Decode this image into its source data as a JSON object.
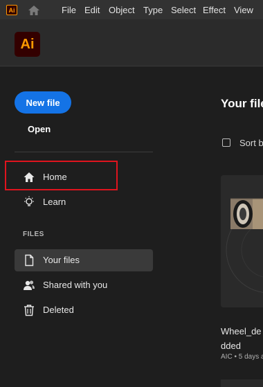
{
  "menubar": {
    "app_icon_label": "Ai",
    "items": [
      "File",
      "Edit",
      "Object",
      "Type",
      "Select",
      "Effect",
      "View"
    ]
  },
  "header": {
    "logo_label": "Ai"
  },
  "sidebar": {
    "new_file_label": "New file",
    "open_label": "Open",
    "nav": [
      {
        "label": "Home",
        "icon": "home-icon"
      },
      {
        "label": "Learn",
        "icon": "lightbulb-icon"
      }
    ],
    "files_section_label": "FILES",
    "files_nav": [
      {
        "label": "Your files",
        "icon": "file-icon",
        "selected": true
      },
      {
        "label": "Shared with you",
        "icon": "users-icon",
        "selected": false
      },
      {
        "label": "Deleted",
        "icon": "trash-icon",
        "selected": false
      }
    ]
  },
  "main": {
    "title": "Your file",
    "sort_label": "Sort b",
    "file": {
      "name_line1": "Wheel_de",
      "name_line2": "dded",
      "meta": "AIC • 5 days a"
    }
  },
  "colors": {
    "accent": "#1473e6",
    "highlight": "#e0141e",
    "ai_orange": "#ff9a00",
    "ai_bg": "#330000"
  }
}
